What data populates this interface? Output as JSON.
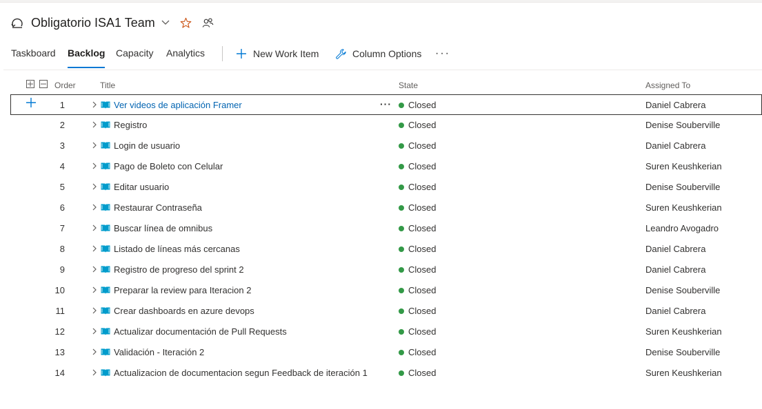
{
  "header": {
    "team_name": "Obligatorio ISA1 Team"
  },
  "tabs": [
    {
      "label": "Taskboard"
    },
    {
      "label": "Backlog"
    },
    {
      "label": "Capacity"
    },
    {
      "label": "Analytics"
    }
  ],
  "toolbar": {
    "new_work_item": "New Work Item",
    "column_options": "Column Options",
    "more": "···"
  },
  "columns": {
    "order": "Order",
    "title": "Title",
    "state": "State",
    "assigned_to": "Assigned To"
  },
  "colors": {
    "accent": "#0078d4",
    "link": "#0063b1",
    "closed_state": "#339947",
    "story_icon": "#009ccc",
    "favorite_star": "#ca5010"
  },
  "rows": [
    {
      "order": "1",
      "title": "Ver videos de aplicación Framer",
      "state": "Closed",
      "assigned": "Daniel Cabrera"
    },
    {
      "order": "2",
      "title": "Registro",
      "state": "Closed",
      "assigned": "Denise Souberville"
    },
    {
      "order": "3",
      "title": "Login de usuario",
      "state": "Closed",
      "assigned": "Daniel Cabrera"
    },
    {
      "order": "4",
      "title": "Pago de Boleto con Celular",
      "state": "Closed",
      "assigned": "Suren Keushkerian"
    },
    {
      "order": "5",
      "title": "Editar usuario",
      "state": "Closed",
      "assigned": "Denise Souberville"
    },
    {
      "order": "6",
      "title": "Restaurar Contraseña",
      "state": "Closed",
      "assigned": "Suren Keushkerian"
    },
    {
      "order": "7",
      "title": "Buscar línea de omnibus",
      "state": "Closed",
      "assigned": "Leandro Avogadro"
    },
    {
      "order": "8",
      "title": "Listado de líneas más cercanas",
      "state": "Closed",
      "assigned": "Daniel Cabrera"
    },
    {
      "order": "9",
      "title": "Registro de progreso del sprint 2",
      "state": "Closed",
      "assigned": "Daniel Cabrera"
    },
    {
      "order": "10",
      "title": "Preparar la review para Iteracion 2",
      "state": "Closed",
      "assigned": "Denise Souberville"
    },
    {
      "order": "11",
      "title": "Crear dashboards en azure devops",
      "state": "Closed",
      "assigned": "Daniel Cabrera"
    },
    {
      "order": "12",
      "title": "Actualizar documentación de Pull Requests",
      "state": "Closed",
      "assigned": "Suren Keushkerian"
    },
    {
      "order": "13",
      "title": "Validación - Iteración 2",
      "state": "Closed",
      "assigned": "Denise Souberville"
    },
    {
      "order": "14",
      "title": "Actualizacion de documentacion segun Feedback de iteración 1",
      "state": "Closed",
      "assigned": "Suren Keushkerian"
    }
  ]
}
